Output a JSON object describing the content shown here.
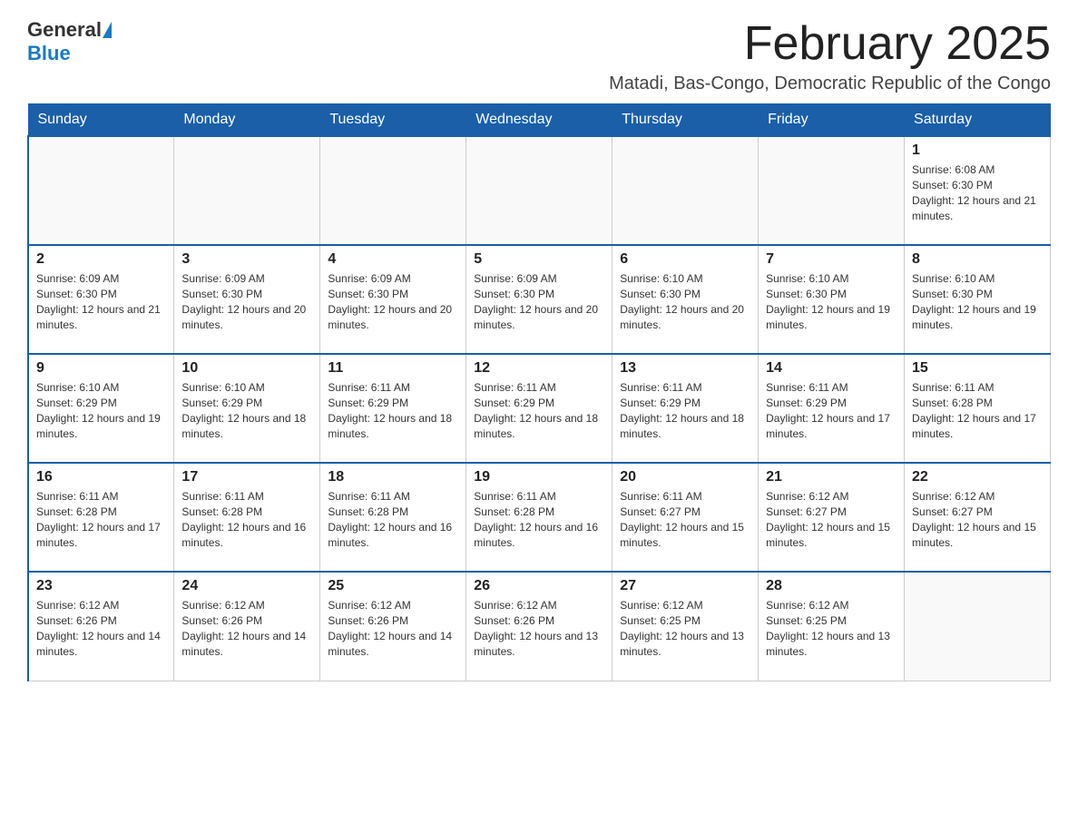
{
  "logo": {
    "general": "General",
    "blue": "Blue"
  },
  "title": "February 2025",
  "subtitle": "Matadi, Bas-Congo, Democratic Republic of the Congo",
  "days_of_week": [
    "Sunday",
    "Monday",
    "Tuesday",
    "Wednesday",
    "Thursday",
    "Friday",
    "Saturday"
  ],
  "weeks": [
    [
      {
        "day": "",
        "info": ""
      },
      {
        "day": "",
        "info": ""
      },
      {
        "day": "",
        "info": ""
      },
      {
        "day": "",
        "info": ""
      },
      {
        "day": "",
        "info": ""
      },
      {
        "day": "",
        "info": ""
      },
      {
        "day": "1",
        "info": "Sunrise: 6:08 AM\nSunset: 6:30 PM\nDaylight: 12 hours and 21 minutes."
      }
    ],
    [
      {
        "day": "2",
        "info": "Sunrise: 6:09 AM\nSunset: 6:30 PM\nDaylight: 12 hours and 21 minutes."
      },
      {
        "day": "3",
        "info": "Sunrise: 6:09 AM\nSunset: 6:30 PM\nDaylight: 12 hours and 20 minutes."
      },
      {
        "day": "4",
        "info": "Sunrise: 6:09 AM\nSunset: 6:30 PM\nDaylight: 12 hours and 20 minutes."
      },
      {
        "day": "5",
        "info": "Sunrise: 6:09 AM\nSunset: 6:30 PM\nDaylight: 12 hours and 20 minutes."
      },
      {
        "day": "6",
        "info": "Sunrise: 6:10 AM\nSunset: 6:30 PM\nDaylight: 12 hours and 20 minutes."
      },
      {
        "day": "7",
        "info": "Sunrise: 6:10 AM\nSunset: 6:30 PM\nDaylight: 12 hours and 19 minutes."
      },
      {
        "day": "8",
        "info": "Sunrise: 6:10 AM\nSunset: 6:30 PM\nDaylight: 12 hours and 19 minutes."
      }
    ],
    [
      {
        "day": "9",
        "info": "Sunrise: 6:10 AM\nSunset: 6:29 PM\nDaylight: 12 hours and 19 minutes."
      },
      {
        "day": "10",
        "info": "Sunrise: 6:10 AM\nSunset: 6:29 PM\nDaylight: 12 hours and 18 minutes."
      },
      {
        "day": "11",
        "info": "Sunrise: 6:11 AM\nSunset: 6:29 PM\nDaylight: 12 hours and 18 minutes."
      },
      {
        "day": "12",
        "info": "Sunrise: 6:11 AM\nSunset: 6:29 PM\nDaylight: 12 hours and 18 minutes."
      },
      {
        "day": "13",
        "info": "Sunrise: 6:11 AM\nSunset: 6:29 PM\nDaylight: 12 hours and 18 minutes."
      },
      {
        "day": "14",
        "info": "Sunrise: 6:11 AM\nSunset: 6:29 PM\nDaylight: 12 hours and 17 minutes."
      },
      {
        "day": "15",
        "info": "Sunrise: 6:11 AM\nSunset: 6:28 PM\nDaylight: 12 hours and 17 minutes."
      }
    ],
    [
      {
        "day": "16",
        "info": "Sunrise: 6:11 AM\nSunset: 6:28 PM\nDaylight: 12 hours and 17 minutes."
      },
      {
        "day": "17",
        "info": "Sunrise: 6:11 AM\nSunset: 6:28 PM\nDaylight: 12 hours and 16 minutes."
      },
      {
        "day": "18",
        "info": "Sunrise: 6:11 AM\nSunset: 6:28 PM\nDaylight: 12 hours and 16 minutes."
      },
      {
        "day": "19",
        "info": "Sunrise: 6:11 AM\nSunset: 6:28 PM\nDaylight: 12 hours and 16 minutes."
      },
      {
        "day": "20",
        "info": "Sunrise: 6:11 AM\nSunset: 6:27 PM\nDaylight: 12 hours and 15 minutes."
      },
      {
        "day": "21",
        "info": "Sunrise: 6:12 AM\nSunset: 6:27 PM\nDaylight: 12 hours and 15 minutes."
      },
      {
        "day": "22",
        "info": "Sunrise: 6:12 AM\nSunset: 6:27 PM\nDaylight: 12 hours and 15 minutes."
      }
    ],
    [
      {
        "day": "23",
        "info": "Sunrise: 6:12 AM\nSunset: 6:26 PM\nDaylight: 12 hours and 14 minutes."
      },
      {
        "day": "24",
        "info": "Sunrise: 6:12 AM\nSunset: 6:26 PM\nDaylight: 12 hours and 14 minutes."
      },
      {
        "day": "25",
        "info": "Sunrise: 6:12 AM\nSunset: 6:26 PM\nDaylight: 12 hours and 14 minutes."
      },
      {
        "day": "26",
        "info": "Sunrise: 6:12 AM\nSunset: 6:26 PM\nDaylight: 12 hours and 13 minutes."
      },
      {
        "day": "27",
        "info": "Sunrise: 6:12 AM\nSunset: 6:25 PM\nDaylight: 12 hours and 13 minutes."
      },
      {
        "day": "28",
        "info": "Sunrise: 6:12 AM\nSunset: 6:25 PM\nDaylight: 12 hours and 13 minutes."
      },
      {
        "day": "",
        "info": ""
      }
    ]
  ]
}
